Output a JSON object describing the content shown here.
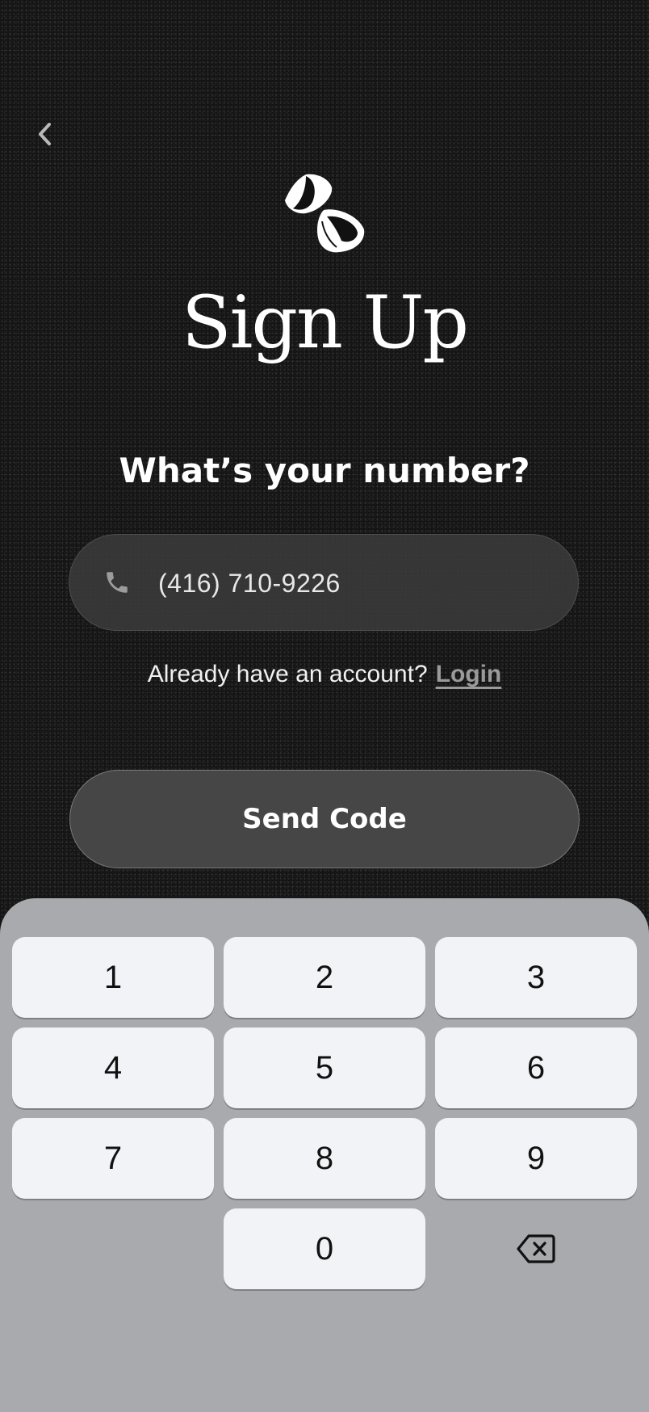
{
  "header": {
    "back_icon": "chevron-left-icon",
    "logo_icon": "hourglass-icon"
  },
  "main": {
    "title": "Sign Up",
    "prompt": "What’s your number?",
    "phone_field": {
      "icon": "phone-icon",
      "value": "(416) 710-9226"
    },
    "account_text": "Already have an account?",
    "login_link": "Login",
    "send_button": "Send Code"
  },
  "keypad": {
    "keys": [
      "1",
      "2",
      "3",
      "4",
      "5",
      "6",
      "7",
      "8",
      "9",
      "0"
    ],
    "delete_icon": "backspace-icon"
  },
  "colors": {
    "background": "#111111",
    "field": "#3a3a3a",
    "button": "#464646",
    "keypad": "#a8aaad",
    "key": "#f2f3f6",
    "link": "#9a9a9a"
  }
}
